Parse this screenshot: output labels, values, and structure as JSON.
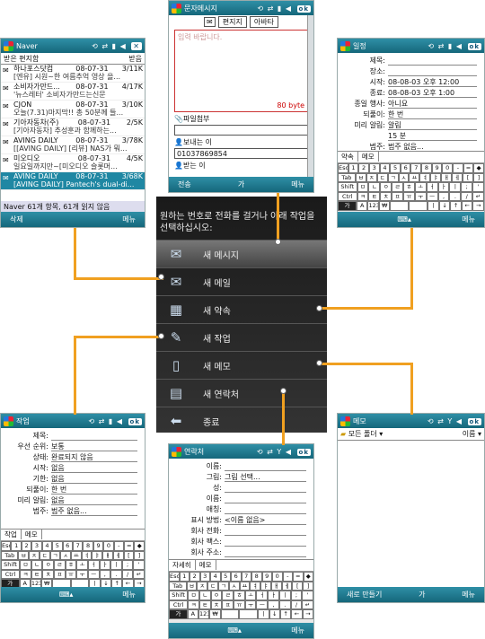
{
  "naver": {
    "title": "Naver",
    "inbox": "받은 편지함",
    "inbox_dd": "받음",
    "rows": [
      {
        "from": "하나포스닷컴",
        "date": "08-07-31",
        "size": "3/11K",
        "subj": "[엔유] 시원~한 여름추억 영상 을..."
      },
      {
        "from": "소비자가만드...",
        "date": "08-07-31",
        "size": "4/17K",
        "subj": "'뉴스레터' 소비자가만드는신문"
      },
      {
        "from": "CJON",
        "date": "08-07-31",
        "size": "3/10K",
        "subj": "오늘(7.31)마지막!! 총 50분께 들..."
      },
      {
        "from": "기아자동차(주)",
        "date": "08-07-31",
        "size": "2/5K",
        "subj": "[기아자동차] 추성훈과 함께하는..."
      },
      {
        "from": "AVING DAILY",
        "date": "08-07-31",
        "size": "3/78K",
        "subj": "[[AVING DAILY] [리뷰] NAS가 뭐..."
      },
      {
        "from": "미오디오",
        "date": "08-07-31",
        "size": "4/5K",
        "subj": "일요일까지만~[미오디오 슬롯머..."
      },
      {
        "from": "AVING DAILY",
        "date": "08-07-31",
        "size": "3/68K",
        "subj": "[AVING DAILY] Pantech's dual-di..."
      }
    ],
    "status": "Naver  61개 항목, 61개 읽지 않음",
    "sk_left": "삭제",
    "sk_right": "메뉴"
  },
  "sms": {
    "title": "문자메시지",
    "btn1": "편지지",
    "btn2": "아바타",
    "placeholder": "입력 바랍니다.",
    "bytes": "80 byte",
    "attach": "파일첨부",
    "sender": "보내는 이",
    "sender_no": "01037869854",
    "recipient": "받는 이",
    "sk_left": "전송",
    "sk_mid": "가",
    "sk_right": "메뉴"
  },
  "cal": {
    "title": "일정",
    "rows": [
      {
        "l": "제목:",
        "v": ""
      },
      {
        "l": "장소:",
        "v": ""
      },
      {
        "l": "시작:",
        "v": "08-08-03   오후 12:00"
      },
      {
        "l": "종료:",
        "v": "08-08-03   오후 1:00"
      },
      {
        "l": "종일 행사:",
        "v": "아니요"
      },
      {
        "l": "되풀이:",
        "v": "한 번"
      },
      {
        "l": "미리 알림:",
        "v": "알림"
      },
      {
        "l": "",
        "v": "15    분"
      },
      {
        "l": "범주:",
        "v": "범주 없음..."
      }
    ],
    "tabs": [
      "약속",
      "메모"
    ]
  },
  "menu": {
    "header": "원하는 번호로 전화를 걸거나 아래 작업을 선택하십시오:",
    "items": [
      "새 메시지",
      "새 메일",
      "새 약속",
      "새 작업",
      "새 메모",
      "새 연락처",
      "종료"
    ]
  },
  "task": {
    "title": "작업",
    "rows": [
      {
        "l": "제목:",
        "v": ""
      },
      {
        "l": "우선 순위:",
        "v": "보통"
      },
      {
        "l": "상태:",
        "v": "완료되지 않음"
      },
      {
        "l": "시작:",
        "v": "없음"
      },
      {
        "l": "기한:",
        "v": "없음"
      },
      {
        "l": "되풀이:",
        "v": "한 번"
      },
      {
        "l": "미리 알림:",
        "v": "없음"
      },
      {
        "l": "범주:",
        "v": "범주 없음..."
      }
    ],
    "tabs": [
      "작업",
      "메모"
    ]
  },
  "contact": {
    "title": "연락처",
    "rows": [
      {
        "l": "이름:",
        "v": ""
      },
      {
        "l": "그림:",
        "v": "그림 선택..."
      },
      {
        "l": "성:",
        "v": ""
      },
      {
        "l": "이름:",
        "v": ""
      },
      {
        "l": "애칭:",
        "v": ""
      },
      {
        "l": "표시 방법:",
        "v": "<이름 없음>"
      },
      {
        "l": "회사 전화:",
        "v": ""
      },
      {
        "l": "회사 팩스:",
        "v": ""
      },
      {
        "l": "회사 주소:",
        "v": ""
      }
    ],
    "tabs": [
      "자세히",
      "메모"
    ]
  },
  "memo": {
    "title": "메모",
    "folder": "모든 폴더",
    "sort": "이름",
    "sk_left": "새로 만들기",
    "sk_mid": "가",
    "sk_right": "메뉴"
  },
  "kbd": {
    "r1": [
      "Esc",
      "1",
      "2",
      "3",
      "4",
      "5",
      "6",
      "7",
      "8",
      "9",
      "0",
      "-",
      "=",
      "◆"
    ],
    "r2": [
      "Tab",
      "ㅂ",
      "ㅈ",
      "ㄷ",
      "ㄱ",
      "ㅅ",
      "ㅛ",
      "ㅕ",
      "ㅑ",
      "ㅐ",
      "ㅔ",
      "[",
      "]"
    ],
    "r3": [
      "Shift",
      "ㅁ",
      "ㄴ",
      "ㅇ",
      "ㄹ",
      "ㅎ",
      "ㅗ",
      "ㅓ",
      "ㅏ",
      "ㅣ",
      ";",
      "'"
    ],
    "r4": [
      "Ctrl",
      "ㅋ",
      "ㅌ",
      "ㅊ",
      "ㅍ",
      "ㅠ",
      "ㅜ",
      "ㅡ",
      ",",
      ".",
      "/",
      "↵"
    ],
    "r5": [
      "가",
      "A",
      "123",
      "₩",
      "",
      "",
      "ㅣ",
      "↓",
      "↑",
      "←",
      "→"
    ]
  },
  "sk_menu": "메뉴",
  "colors": {
    "bar": "#1d7b91",
    "line": "#f0a020"
  }
}
